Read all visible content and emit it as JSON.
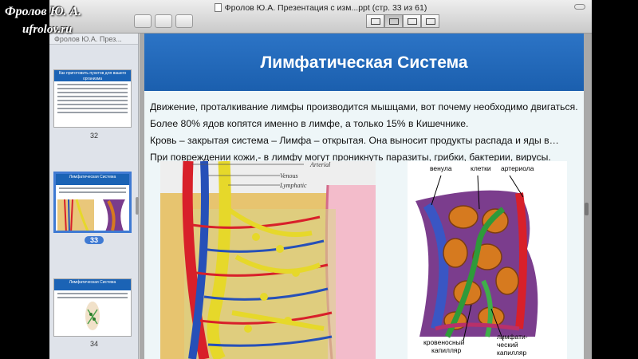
{
  "watermark": {
    "line1": "Фролов Ю. А.",
    "line2": "ufrolov.ru"
  },
  "window": {
    "title": "Фролов Ю.А. Презентация с изм...ppt (стр. 33 из 61)",
    "view_buttons": [
      "single-page-icon",
      "continuous-icon",
      "two-page-icon",
      "contact-sheet-icon"
    ],
    "toolbar_left_icons": [
      "sidebar-icon",
      "grid-icon",
      "annotate-icon"
    ]
  },
  "sidebar": {
    "header": "Фролов Ю.А. През...",
    "pages": [
      {
        "number": "32",
        "thumb_title": "Как приготовить пунктов для вашего организма"
      },
      {
        "number": "33",
        "thumb_title": "Лимфатическая Система",
        "selected": true
      },
      {
        "number": "34",
        "thumb_title": "Лимфатическая Система"
      }
    ]
  },
  "slide": {
    "title": "Лимфатическая Система",
    "lines": [
      "Движение, проталкивание лимфы производится мышцами, вот почему необходимо двигаться.",
      "Более 80% ядов копятся именно в лимфе,  а только 15% в Кишечнике.",
      "Кровь – закрытая система – Лимфа – открытая. Она выносит продукты распада и яды в…",
      "При повреждении кожи,- в лимфу могут проникнуть паразиты, грибки, бактерии, вирусы."
    ],
    "figure1_labels": {
      "arterial": "Arterial",
      "venous": "Venous",
      "lymphatic": "Lymphatic"
    },
    "figure2_labels": {
      "venule": "венула",
      "cells": "клетки",
      "arteriole": "артериола",
      "blood_cap_1": "кровеносный",
      "blood_cap_2": "капилляр",
      "lymph_cap_1": "лимфати-",
      "lymph_cap_2": "ческий",
      "lymph_cap_3": "капилляр"
    }
  },
  "colors": {
    "slide_header": "#1b5fae",
    "selected_page": "#3f7ad3",
    "artery": "#d8202a",
    "vein": "#2650b8",
    "lymph": "#e6d82a"
  }
}
